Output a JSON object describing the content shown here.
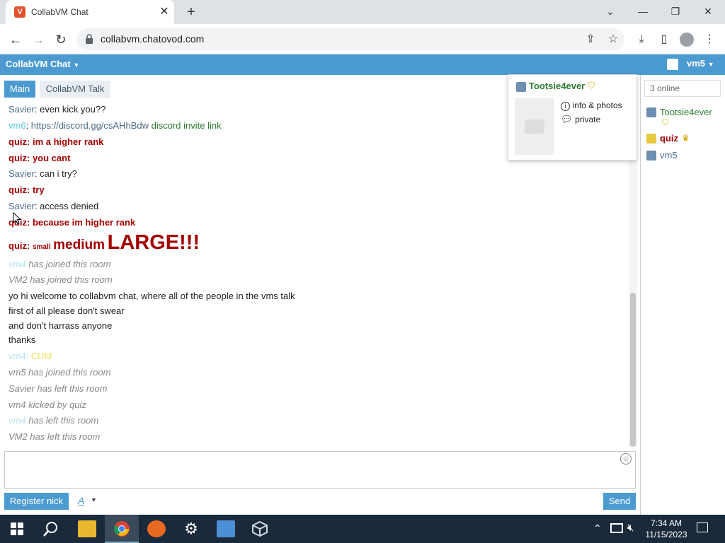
{
  "browser": {
    "tab_title": "CollabVM Chat",
    "favicon_letter": "V",
    "url": "collabvm.chatovod.com"
  },
  "header": {
    "app_name": "CollabVM Chat",
    "user_name": "vm5"
  },
  "tabs": {
    "main": "Main",
    "talk": "CollabVM Talk"
  },
  "messages": {
    "m1": {
      "name": "Savier",
      "text": "even kick you??"
    },
    "m2": {
      "name": "vm6",
      "link": "https://discord.gg/csAHhBdw",
      "text": "discord invite link"
    },
    "m3": {
      "name": "quiz",
      "text": "im a higher rank"
    },
    "m4": {
      "name": "quiz",
      "text": "you cant"
    },
    "m5": {
      "name": "Savier",
      "text": "can i try?"
    },
    "m6": {
      "name": "quiz",
      "text": "try"
    },
    "m7": {
      "name": "Savier",
      "text": "access denied"
    },
    "m8": {
      "name": "quiz",
      "text": "because im higher rank"
    },
    "m9": {
      "name": "quiz",
      "small": "small",
      "medium": "medium",
      "large": "LARGE!!!"
    },
    "s1": {
      "name": "vm4",
      "text": "has joined this room"
    },
    "s2": {
      "name": "VM2",
      "text": "has joined this room"
    },
    "w1": "yo hi welcome to collabvm chat, where all of the people in the vms talk",
    "w2": "first of all please don't swear",
    "w3": "and don't harrass anyone",
    "w4": "thanks",
    "m10": {
      "name": "vm4",
      "text": "CUM"
    },
    "s3": "vm5 has joined this room",
    "s4": "Savier has left this room",
    "s5": "vm4 kicked by quiz",
    "s6": {
      "name": "vm4",
      "text": "has left this room"
    },
    "s7": "VM2 has left this room",
    "sep": ": "
  },
  "input": {
    "register_label": "Register nick",
    "font_label": "A",
    "send_label": "Send"
  },
  "sidebar": {
    "online_count": "3 online",
    "users": [
      "Tootsie4ever",
      "quiz",
      "vm5"
    ]
  },
  "popup": {
    "user": "Tootsie4ever",
    "info_label": "info & photos",
    "private_label": "private"
  },
  "taskbar": {
    "time": "7:34 AM",
    "date": "11/15/2023"
  },
  "colors": {
    "accent": "#4b9bd1",
    "quiz": "#a40000",
    "green_user": "#2e7d32"
  }
}
